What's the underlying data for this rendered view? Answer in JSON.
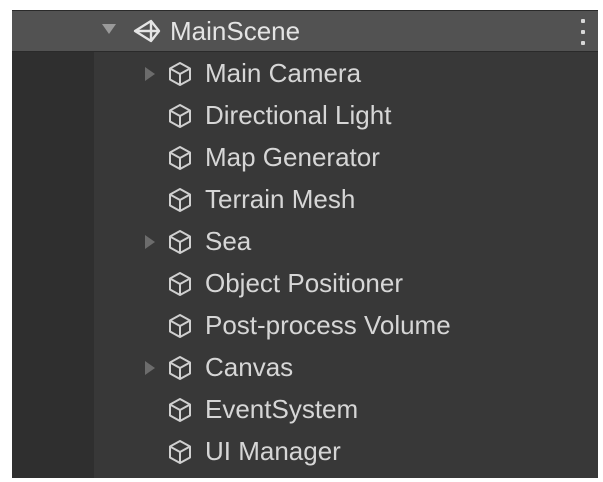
{
  "hierarchy": {
    "scene": {
      "title": "MainScene",
      "icon": "unity-scene-icon",
      "expanded": true,
      "menu_icon": "kebab-menu-icon"
    },
    "items": [
      {
        "label": "Main Camera",
        "icon": "cube-icon",
        "has_children": true
      },
      {
        "label": "Directional Light",
        "icon": "cube-icon",
        "has_children": false
      },
      {
        "label": "Map Generator",
        "icon": "cube-icon",
        "has_children": false
      },
      {
        "label": "Terrain Mesh",
        "icon": "cube-icon",
        "has_children": false
      },
      {
        "label": "Sea",
        "icon": "cube-icon",
        "has_children": true
      },
      {
        "label": "Object Positioner",
        "icon": "cube-icon",
        "has_children": false
      },
      {
        "label": "Post-process Volume",
        "icon": "cube-icon",
        "has_children": false
      },
      {
        "label": "Canvas",
        "icon": "cube-icon",
        "has_children": true
      },
      {
        "label": "EventSystem",
        "icon": "cube-icon",
        "has_children": false
      },
      {
        "label": "UI Manager",
        "icon": "cube-icon",
        "has_children": false
      }
    ]
  },
  "colors": {
    "panel_background": "#383838",
    "header_background": "#525252",
    "text": "#d6d6d6",
    "icon": "#d0d0d0"
  }
}
